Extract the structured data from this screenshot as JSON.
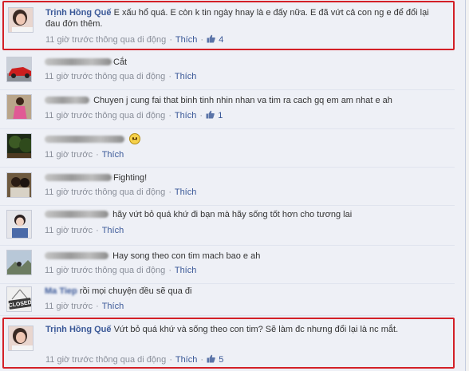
{
  "comments": [
    {
      "author": "Trịnh Hồng Quế",
      "text": "E xấu hổ quá. E còn k tin ngày hnay là e đấy nữa. E đã vứt cả con ng e để đổi lại đau đớn thêm.",
      "time": "11 giờ trước thông qua di động",
      "like_label": "Thích",
      "likes": "4",
      "highlighted": true,
      "avatar_icon": "woman-photo-avatar"
    },
    {
      "author": "",
      "text": "Cắt",
      "time": "11 giờ trước thông qua di động",
      "like_label": "Thích",
      "likes": "",
      "highlighted": false,
      "avatar_icon": "red-car-avatar"
    },
    {
      "author": "",
      "text": "Chuyen j cung fai that binh tinh nhin nhan va tim ra cach gq em am nhat e ah",
      "time": "11 giờ trước thông qua di động",
      "like_label": "Thích",
      "likes": "1",
      "highlighted": false,
      "avatar_icon": "pink-dress-avatar"
    },
    {
      "author": "",
      "text": "",
      "emoji": "sad-face-icon",
      "time": "11 giờ trước",
      "like_label": "Thích",
      "likes": "",
      "highlighted": false,
      "avatar_icon": "forest-avatar"
    },
    {
      "author": "",
      "text": "Fighting!",
      "time": "11 giờ trước thông qua di động",
      "like_label": "Thích",
      "likes": "",
      "highlighted": false,
      "avatar_icon": "couple-avatar"
    },
    {
      "author": "",
      "text": "hãy vứt bỏ quá khứ đi bạn mà hãy sống tốt hơn cho tương lai",
      "time": "11 giờ trước",
      "like_label": "Thích",
      "likes": "",
      "highlighted": false,
      "avatar_icon": "girl-avatar"
    },
    {
      "author": "",
      "text": "Hay song theo con tim mach bao e ah",
      "time": "11 giờ trước thông qua di động",
      "like_label": "Thích",
      "likes": "",
      "highlighted": false,
      "avatar_icon": "mountain-avatar"
    },
    {
      "author": "Ma Tiep",
      "text": "rồi mọi chuyện đều sẽ qua đi",
      "time": "11 giờ trước",
      "like_label": "Thích",
      "likes": "",
      "highlighted": false,
      "avatar_icon": "closed-sign-avatar",
      "avatar_text": "CLOSED"
    },
    {
      "author": "Trịnh Hồng Quế",
      "text": "Vứt bỏ quá khứ và sống theo con tim? Sẽ làm đc nhưng đổi lại là nc mắt.",
      "time": "11 giờ trước thông qua di động",
      "like_label": "Thích",
      "likes": "5",
      "highlighted": true,
      "avatar_icon": "woman-photo-avatar"
    }
  ],
  "colors": {
    "link": "#3b5998",
    "highlight_border": "#d32027",
    "background": "#eef0f6",
    "meta": "#8a8f9a"
  }
}
